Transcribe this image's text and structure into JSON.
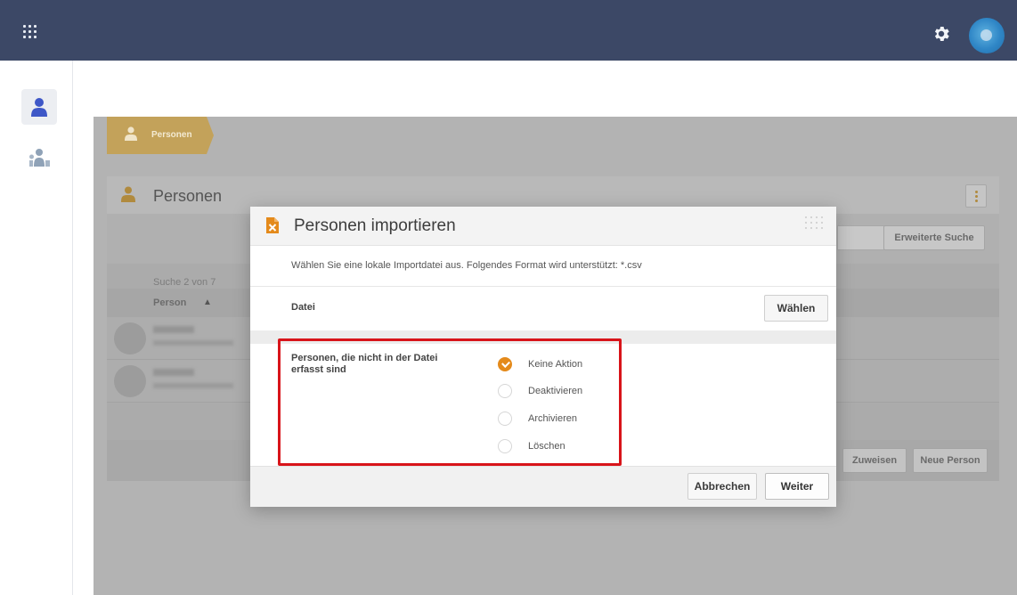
{
  "topbar": {
    "bg": "#3c4866",
    "apps_icon": "apps-grid-icon",
    "settings_icon": "gear-icon",
    "avatar": "avatar"
  },
  "sidebar": {
    "items": [
      {
        "icon": "person-icon",
        "active": true
      },
      {
        "icon": "people-group-icon",
        "active": false
      }
    ]
  },
  "breadcrumb": {
    "label": "Personen",
    "icon": "person-icon"
  },
  "panel": {
    "title": "Personen",
    "advanced_search_label": "Erweiterte Suche",
    "result_count": "Suche 2 von 7",
    "column_person": "Person",
    "sort_icon": "▲",
    "assign_label": "Zuweisen",
    "new_person_label": "Neue Person"
  },
  "modal": {
    "title": "Personen importieren",
    "title_icon": "excel-file-icon",
    "hint": "Wählen Sie eine lokale Importdatei aus. Folgendes Format wird unterstützt: *.csv",
    "file_label": "Datei",
    "choose_label": "Wählen",
    "options_label": "Personen, die nicht in der Datei erfasst sind",
    "options": [
      {
        "label": "Keine Aktion",
        "selected": true
      },
      {
        "label": "Deaktivieren",
        "selected": false
      },
      {
        "label": "Archivieren",
        "selected": false
      },
      {
        "label": "Löschen",
        "selected": false
      }
    ],
    "cancel_label": "Abbrechen",
    "next_label": "Weiter"
  },
  "colors": {
    "accent": "#e48a1b",
    "highlight": "#d8141a"
  }
}
